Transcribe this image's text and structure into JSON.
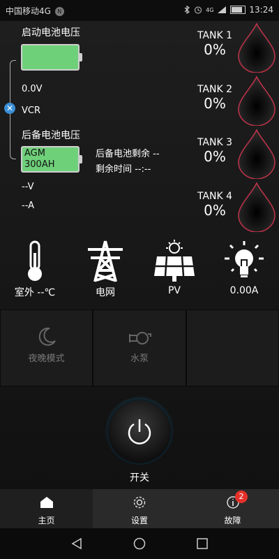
{
  "status_bar": {
    "carrier": "中国移动4G",
    "carrier_badge": "N",
    "net": "4G",
    "time": "13:24"
  },
  "start_battery": {
    "title": "启动电池电压",
    "voltage": "0.0V",
    "vcr": "VCR"
  },
  "backup_battery": {
    "title": "后备电池电压",
    "type": "AGM",
    "capacity": "300AH",
    "remaining": "后备电池剩余 --",
    "remaining_time": "剩余时间 --:--",
    "voltage": "--V",
    "current": "--A"
  },
  "tanks": [
    {
      "name": "TANK 1",
      "value": "0%"
    },
    {
      "name": "TANK 2",
      "value": "0%"
    },
    {
      "name": "TANK 3",
      "value": "0%"
    },
    {
      "name": "TANK 4",
      "value": "0%"
    }
  ],
  "sensors": {
    "outdoor": "室外 --℃",
    "grid": "电网",
    "pv": "PV",
    "light": "0.00A"
  },
  "tiles": {
    "night_mode": "夜晚模式",
    "water_pump": "水泵"
  },
  "power": {
    "label": "开关"
  },
  "tabs": {
    "home": "主页",
    "settings": "设置",
    "fault": "故障",
    "fault_count": "2"
  },
  "colors": {
    "battery_fill": "#6fd07a",
    "tank_border": "#c0334a",
    "badge_red": "#e4312b"
  }
}
